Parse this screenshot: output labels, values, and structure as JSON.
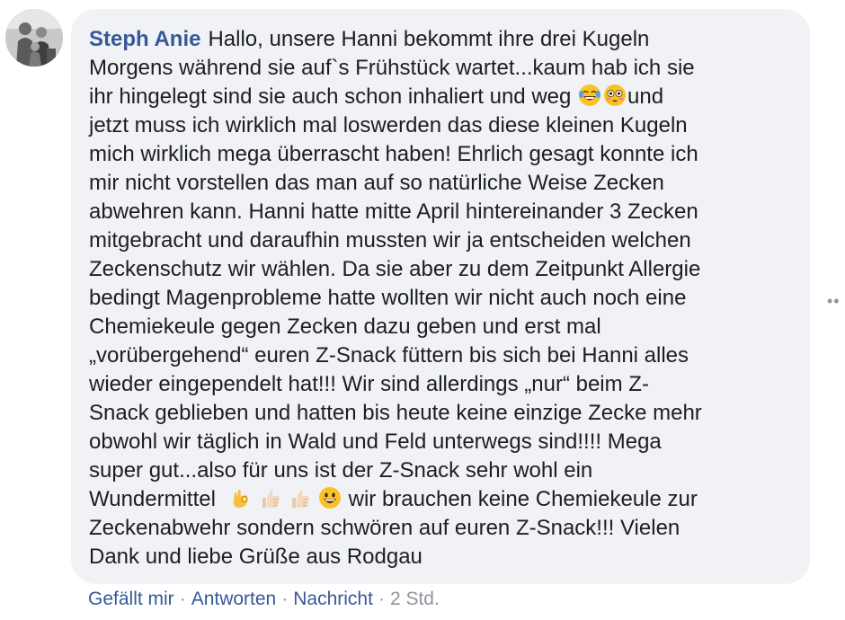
{
  "comment": {
    "author": "Steph Anie",
    "lines": [
      "Hallo, unsere Hanni bekommt ihre drei Kugeln",
      "Morgens während sie auf`s Frühstück wartet...kaum hab ich sie",
      "ihr hingelegt sind sie auch schon inhaliert und weg",
      "und",
      "jetzt muss ich wirklich mal loswerden das diese kleinen Kugeln",
      "mich wirklich mega überrascht haben! Ehrlich gesagt konnte ich",
      "mir nicht vorstellen das man auf so natürliche Weise Zecken",
      "abwehren kann. Hanni hatte mitte April hintereinander 3 Zecken",
      "mitgebracht und daraufhin mussten wir ja entscheiden welchen",
      "Zeckenschutz wir wählen. Da sie aber zu dem Zeitpunkt Allergie",
      "bedingt Magenprobleme hatte wollten wir nicht auch noch eine",
      "Chemiekeule gegen Zecken dazu geben und erst mal",
      "„vorübergehend“ euren Z-Snack füttern bis sich bei Hanni alles",
      "wieder eingependelt hat!!! Wir sind allerdings „nur“ beim Z-",
      "Snack geblieben und hatten bis heute keine einzige Zecke mehr",
      "obwohl wir täglich in Wald und Feld unterwegs sind!!!! Mega",
      "super gut...also für uns ist der Z-Snack sehr wohl ein",
      "Wundermittel",
      "wir brauchen keine Chemiekeule zur",
      "Zeckenabwehr sondern schwören auf euren Z-Snack!!! Vielen",
      "Dank und liebe Grüße aus Rodgau"
    ],
    "emojis": [
      "face-with-tears-of-joy-icon",
      "flushed-face-icon",
      "ok-hand-icon",
      "thumbs-up-icon",
      "thumbs-up-icon",
      "grinning-face-icon"
    ]
  },
  "actions": {
    "like": "Gefällt mir",
    "reply": "Antworten",
    "message": "Nachricht",
    "separator": "·",
    "time": "2 Std."
  },
  "more_label": "••",
  "colors": {
    "author": "#385898",
    "bubble": "#f0f2f5",
    "text": "#1c1e21",
    "meta": "#90949c"
  }
}
